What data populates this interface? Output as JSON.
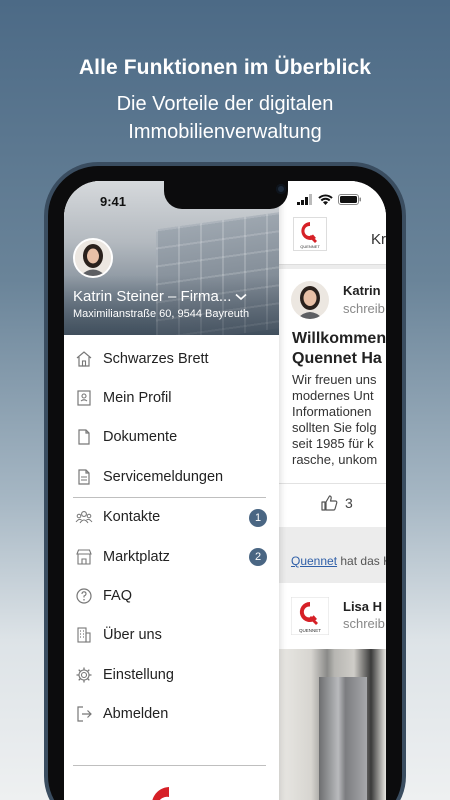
{
  "promo": {
    "title": "Alle Funktionen im Überblick",
    "subtitle_line1": "Die Vorteile der digitalen",
    "subtitle_line2": "Immobilienverwaltung"
  },
  "status_bar": {
    "time": "9:41"
  },
  "drawer": {
    "user_name": "Katrin Steiner – Firma...",
    "address": "Maximilianstraße 60, 9544 Bayreuth",
    "menu_groups": [
      [
        {
          "label": "Schwarzes Brett",
          "icon": "home-icon"
        },
        {
          "label": "Mein Profil",
          "icon": "profile-card-icon"
        },
        {
          "label": "Dokumente",
          "icon": "document-icon"
        },
        {
          "label": "Servicemeldungen",
          "icon": "service-report-icon"
        }
      ],
      [
        {
          "label": "Kontakte",
          "icon": "contacts-icon",
          "badge": "1"
        },
        {
          "label": "Marktplatz",
          "icon": "marketplace-icon",
          "badge": "2"
        },
        {
          "label": "FAQ",
          "icon": "help-icon"
        },
        {
          "label": "Über uns",
          "icon": "building-icon"
        },
        {
          "label": "Einstellung",
          "icon": "gear-icon"
        },
        {
          "label": "Abmelden",
          "icon": "logout-icon"
        }
      ]
    ],
    "badge_color": "#4a6683"
  },
  "feed": {
    "header_text": "Kr",
    "post1": {
      "author": "Katrin",
      "meta": "schreib",
      "title_line1": "Willkommen",
      "title_line2": "Quennet Ha",
      "body": [
        "Wir freuen uns",
        "modernes Unt",
        "Informationen",
        "sollten Sie folg",
        "seit 1985 für k",
        "rasche, unkom"
      ],
      "likes": "3"
    },
    "notice_link": "Quennet",
    "notice_text": " hat das K",
    "post2": {
      "author": "Lisa H",
      "meta": "schreib"
    }
  },
  "colors": {
    "brand_red": "#d62027",
    "accent": "#4a6683"
  }
}
